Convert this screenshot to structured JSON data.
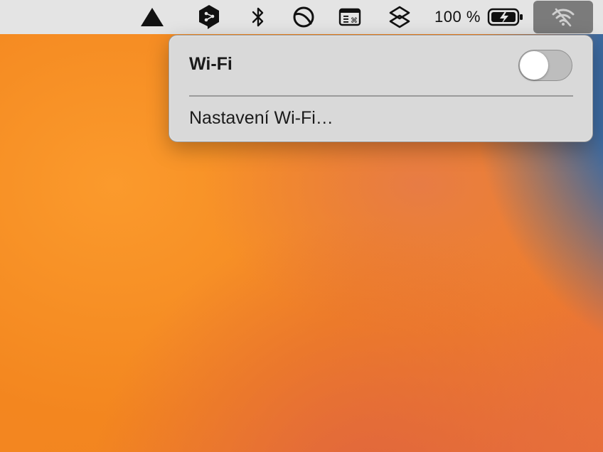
{
  "menubar": {
    "icons": [
      {
        "name": "triangle-app-icon"
      },
      {
        "name": "deepl-icon"
      },
      {
        "name": "bluetooth-icon"
      },
      {
        "name": "circle-slash-app-icon"
      },
      {
        "name": "keyboard-window-icon"
      },
      {
        "name": "layers-stack-icon"
      }
    ],
    "battery_percent": "100 %",
    "battery_icon": "battery-charging-icon",
    "wifi_icon": "wifi-off-icon"
  },
  "wifi_menu": {
    "title": "Wi-Fi",
    "toggle_on": false,
    "settings_label": "Nastavení Wi-Fi…"
  },
  "colors": {
    "menubar_bg": "#e4e4e4",
    "menu_bg": "#d9d9d9",
    "wifi_highlight": "#7b7b7b",
    "desktop_orange": "#f28424",
    "desktop_blue": "#2c63a8"
  }
}
